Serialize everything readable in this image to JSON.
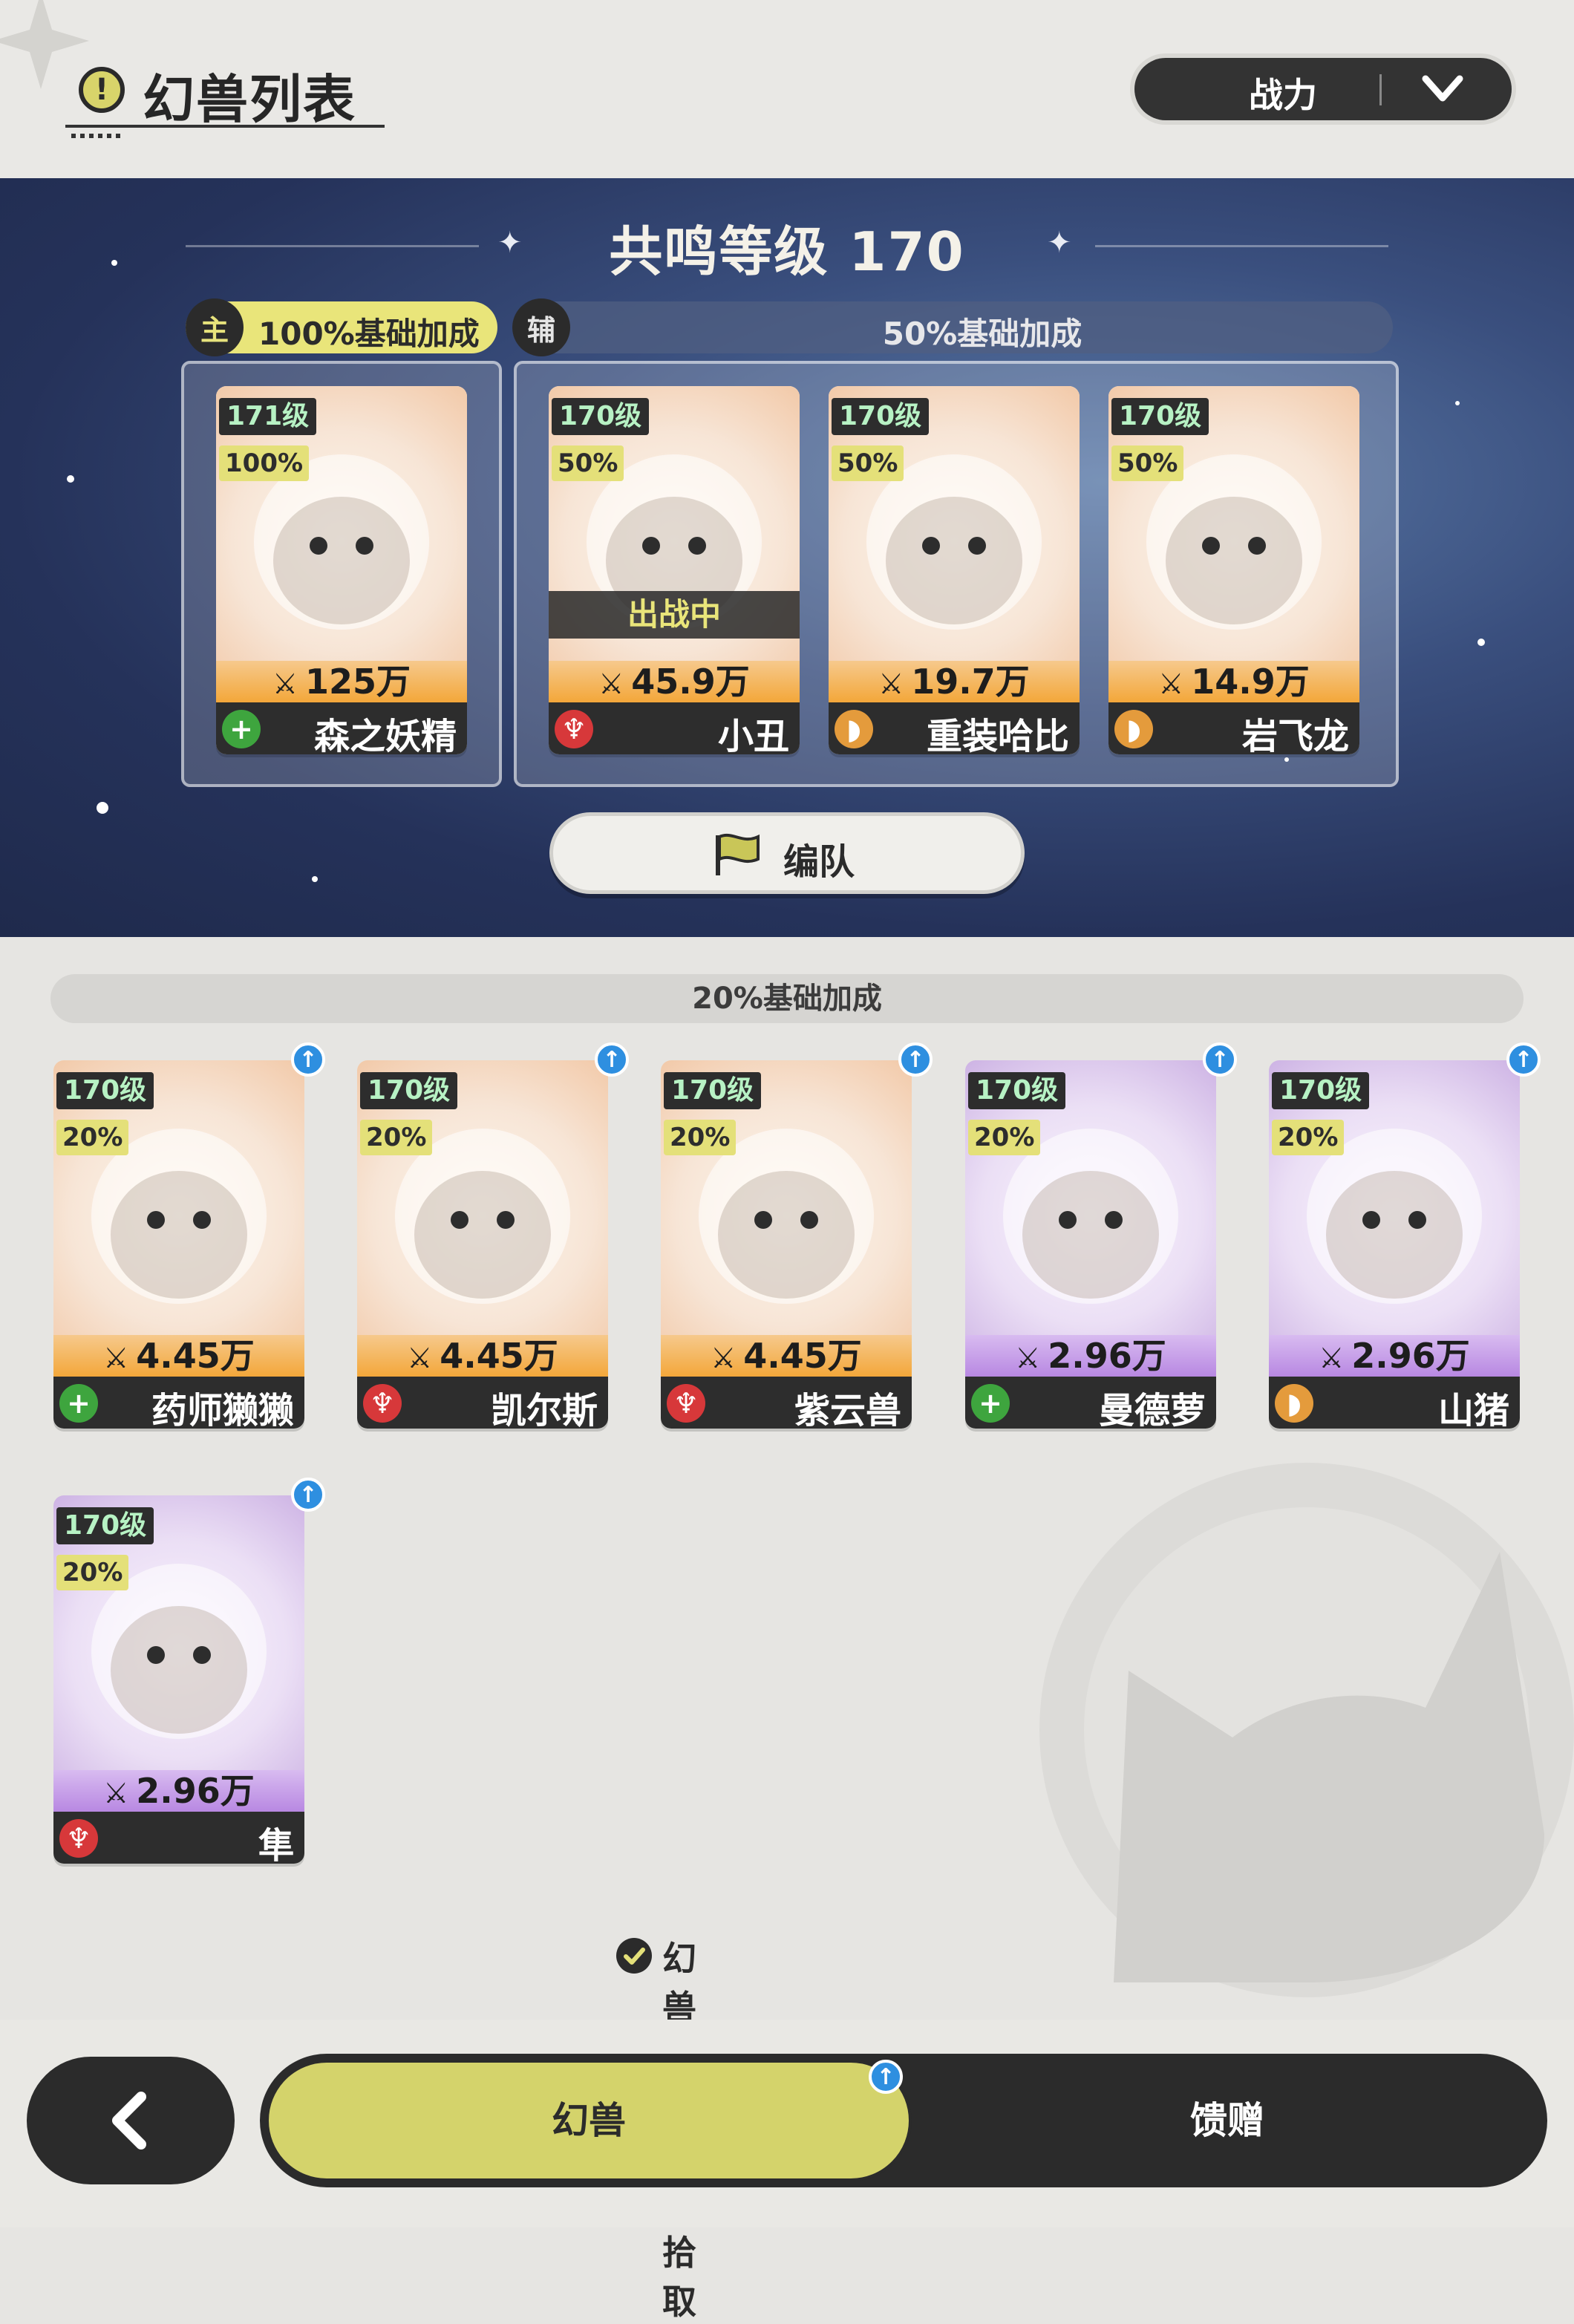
{
  "header": {
    "title": "幻兽列表",
    "title_icon": "!",
    "sort_label": "战力"
  },
  "resonance": {
    "title": "共鸣等级 170",
    "main_badge": "主",
    "main_bonus": "100%基础加成",
    "aux_badge": "辅",
    "aux_bonus": "50%基础加成"
  },
  "team_button": "编队",
  "main_slots": [
    {
      "level": "171级",
      "pct": "100%",
      "power": "125万",
      "name": "森之妖精",
      "role": "heal",
      "theme": "orange"
    }
  ],
  "aux_slots": [
    {
      "level": "170级",
      "pct": "50%",
      "power": "45.9万",
      "name": "小丑",
      "role": "atk",
      "theme": "orange",
      "status": "出战中"
    },
    {
      "level": "170级",
      "pct": "50%",
      "power": "19.7万",
      "name": "重装哈比",
      "role": "tank",
      "theme": "orange"
    },
    {
      "level": "170级",
      "pct": "50%",
      "power": "14.9万",
      "name": "岩飞龙",
      "role": "tank",
      "theme": "orange"
    }
  ],
  "reserve_bonus": "20%基础加成",
  "reserve": [
    {
      "level": "170级",
      "pct": "20%",
      "power": "4.45万",
      "name": "药师獭獭",
      "role": "heal",
      "theme": "orange"
    },
    {
      "level": "170级",
      "pct": "20%",
      "power": "4.45万",
      "name": "凯尔斯",
      "role": "atk",
      "theme": "orange"
    },
    {
      "level": "170级",
      "pct": "20%",
      "power": "4.45万",
      "name": "紫云兽",
      "role": "atk",
      "theme": "orange"
    },
    {
      "level": "170级",
      "pct": "20%",
      "power": "2.96万",
      "name": "曼德萝",
      "role": "heal",
      "theme": "purple"
    },
    {
      "level": "170级",
      "pct": "20%",
      "power": "2.96万",
      "name": "山猪",
      "role": "tank",
      "theme": "purple"
    },
    {
      "level": "170级",
      "pct": "20%",
      "power": "2.96万",
      "name": "隼",
      "role": "atk",
      "theme": "purple"
    }
  ],
  "auto_pickup": "幻兽地图自动拾取",
  "tabs": {
    "active": "幻兽",
    "inactive": "馈赠"
  },
  "icons": {
    "role_heal": "plus-icon",
    "role_atk": "sword-icon",
    "role_tank": "shield-icon",
    "power": "crossed-swords-icon",
    "upgrade": "arrow-up-icon"
  },
  "colors": {
    "accent_yellow": "#d4d36b",
    "dark": "#2b2b2b",
    "orange_card": "#f3a73a",
    "purple_card": "#b888e2",
    "heal": "#3ea53e",
    "atk": "#d7383a",
    "tank": "#e49b3c"
  }
}
